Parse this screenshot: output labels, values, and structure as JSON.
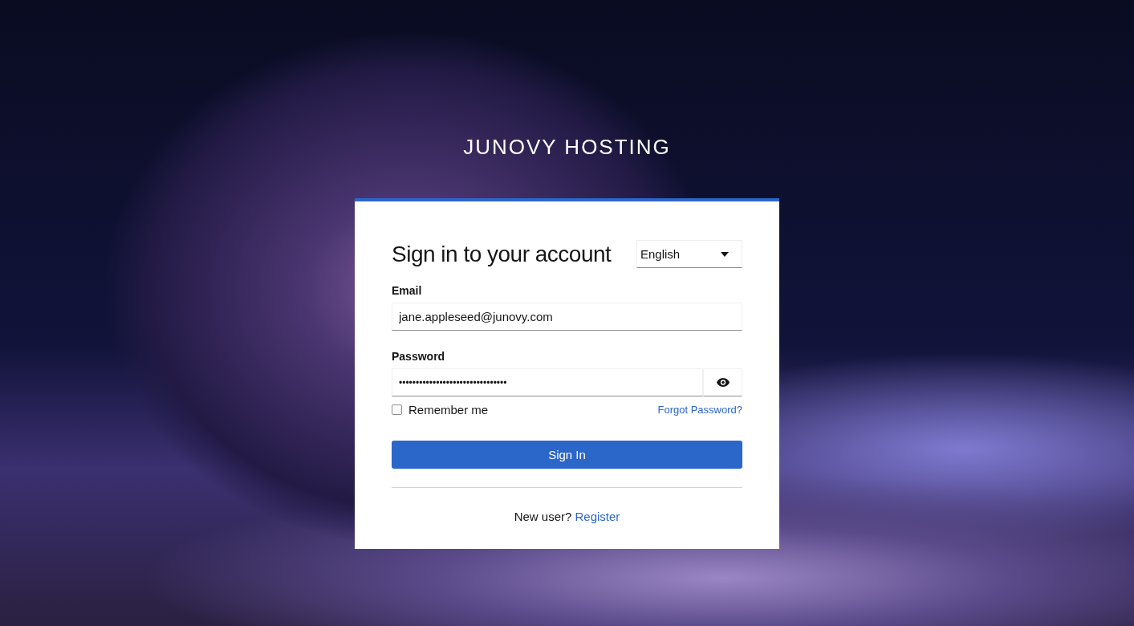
{
  "brand": "JUNOVY HOSTING",
  "form": {
    "title": "Sign in to your account",
    "language": {
      "value": "English"
    },
    "email": {
      "label": "Email",
      "value": "jane.appleseed@junovy.com"
    },
    "password": {
      "label": "Password",
      "value": "••••••••••••••••••••••••••••••••"
    },
    "remember": {
      "label": "Remember me",
      "checked": false
    },
    "forgot_link": "Forgot Password?",
    "submit": "Sign In",
    "register": {
      "prompt": "New user?",
      "link": "Register"
    }
  }
}
